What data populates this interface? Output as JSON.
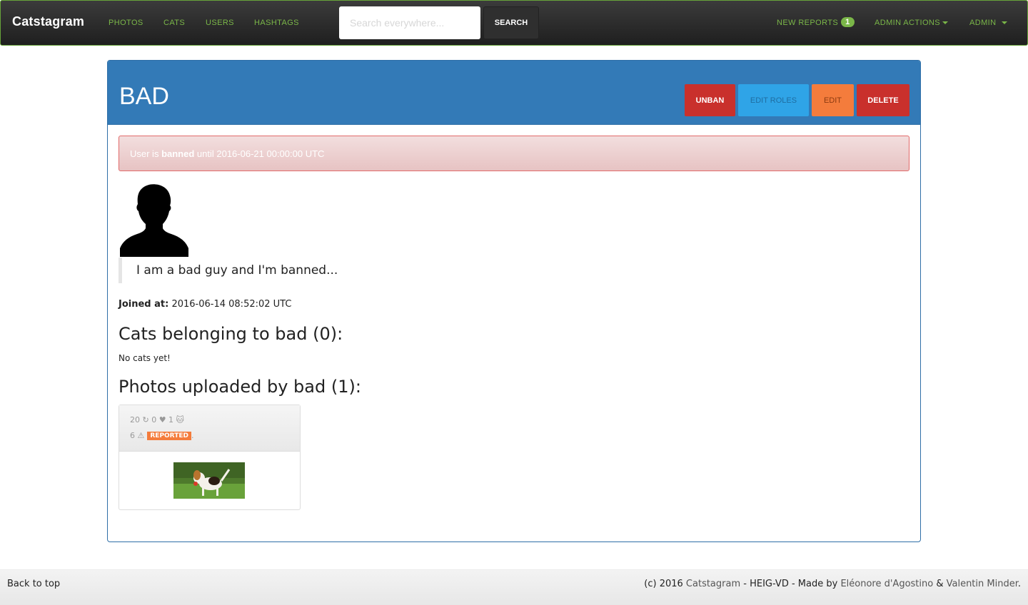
{
  "navbar": {
    "brand": "Catstagram",
    "links": [
      "PHOTOS",
      "CATS",
      "USERS",
      "HASHTAGS"
    ],
    "search_placeholder": "Search everywhere...",
    "search_button": "SEARCH",
    "new_reports_label": "NEW REPORTS",
    "new_reports_count": "1",
    "admin_actions": "ADMIN ACTIONS",
    "admin": "ADMIN"
  },
  "profile": {
    "username_title": "BAD",
    "buttons": {
      "unban": "UNBAN",
      "edit_roles": "EDIT ROLES",
      "edit": "EDIT",
      "delete": "DELETE"
    },
    "alert": {
      "prefix": "User is ",
      "strong": "banned",
      "suffix": " until 2016-06-21 00:00:00 UTC"
    },
    "bio": "I am a bad guy and I'm banned...",
    "joined_label": "Joined at:",
    "joined_value": " 2016-06-14 08:52:02 UTC",
    "cats_heading": "Cats belonging to bad (0):",
    "no_cats": "No cats yet!",
    "photos_heading": "Photos uploaded by bad (1):"
  },
  "photo_card": {
    "stats_text": "20 ↻ 0 ♥ 1 🐱",
    "reports_text": "6 ⚠",
    "reported_badge": "REPORTED",
    "period": "."
  },
  "footer": {
    "back_to_top": "Back to top",
    "credits_prefix": "(c) 2016 ",
    "credits_brand": "Catstagram",
    "credits_middle": " - HEIG-VD - Made by ",
    "author1": "Eléonore d'Agostino",
    "and": " & ",
    "author2": "Valentin Minder",
    "credits_end": "."
  },
  "colors": {
    "navbar_accent": "#7ab648",
    "panel_primary": "#337ab7",
    "danger": "#c9302c",
    "info": "#2fa4e7",
    "warning": "#f47c3c"
  },
  "icons": [
    "avatar-silhouette-icon",
    "retweet-icon",
    "heart-icon",
    "cat-icon",
    "warning-icon",
    "caret-down-icon"
  ]
}
